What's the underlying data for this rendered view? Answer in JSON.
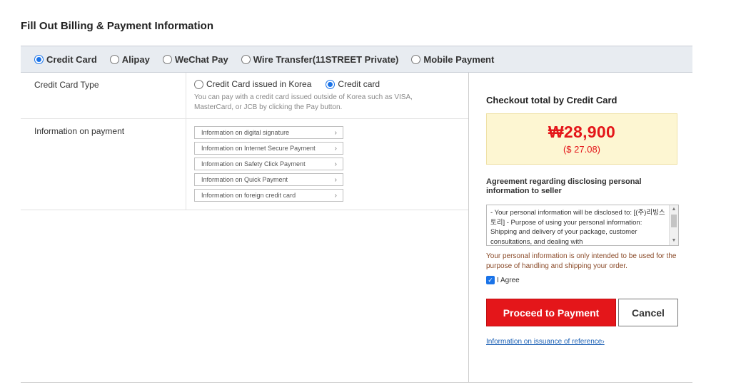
{
  "page": {
    "title": "Fill Out Billing & Payment Information"
  },
  "payment_methods": [
    {
      "label": "Credit Card",
      "selected": true
    },
    {
      "label": "Alipay",
      "selected": false
    },
    {
      "label": "WeChat Pay",
      "selected": false
    },
    {
      "label": "Wire Transfer(11STREET Private)",
      "selected": false
    },
    {
      "label": "Mobile Payment",
      "selected": false
    }
  ],
  "card_type": {
    "label": "Credit Card Type",
    "options": [
      {
        "label": "Credit Card issued in Korea",
        "selected": false
      },
      {
        "label": "Credit card",
        "selected": true
      }
    ],
    "note": "You can pay with a credit card issued outside of Korea such as VISA, MasterCard, or JCB by clicking the Pay button."
  },
  "payment_info": {
    "label": "Information on payment",
    "items": [
      "Information on digital signature",
      "Information on Internet Secure Payment",
      "Information on Safety Click Payment",
      "Information on Quick Payment",
      "Information on foreign credit card"
    ]
  },
  "checkout": {
    "title": "Checkout total by Credit Card",
    "total_krw": "₩28,900",
    "total_usd": "($ 27.08)",
    "agreement_title": "Agreement regarding disclosing personal information to seller",
    "agreement_text": "- Your personal information will be disclosed to: [(주)리빙스토리] - Purpose of using your personal information: Shipping and delivery of your package, customer consultations, and dealing with",
    "privacy_note": "Your personal information is only intended to be used for the purpose of handling and shipping your order.",
    "agree_label": "I Agree",
    "agree_checked": true,
    "proceed_label": "Proceed to Payment",
    "cancel_label": "Cancel",
    "reference_link": "Information on issuance of reference"
  },
  "colors": {
    "accent_red": "#e4161a",
    "price_bg": "#fdf6d2",
    "bar_bg": "#e8ecf1",
    "radio_blue": "#1a73e8"
  },
  "icons": {
    "item_chevron": "chevron-right-icon",
    "link_chevron": "chevron-right-icon",
    "scroll_up": "caret-up-icon",
    "scroll_down": "caret-down-icon"
  }
}
